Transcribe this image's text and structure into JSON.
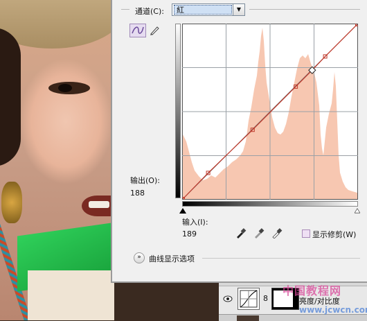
{
  "channel": {
    "label": "通道(C):",
    "value": "紅"
  },
  "curves": {
    "output_label": "输出(O):",
    "output_value": "188",
    "input_label": "输入(I):",
    "input_value": "189",
    "show_clipping_label": "显示修剪(W)",
    "display_options_label": "曲线显示选项",
    "curve_points": [
      [
        0,
        0
      ],
      [
        37,
        38
      ],
      [
        102,
        101
      ],
      [
        165,
        164
      ],
      [
        189,
        188
      ],
      [
        208,
        208
      ],
      [
        255,
        255
      ]
    ],
    "histogram_color": "#f7c7b1",
    "curve_color": "#c0392b"
  },
  "layers": {
    "adjustment_layer_name": "亮度/对比度"
  },
  "watermark": {
    "line1": "中国教程网",
    "line2": "www.jcwcn.com"
  }
}
